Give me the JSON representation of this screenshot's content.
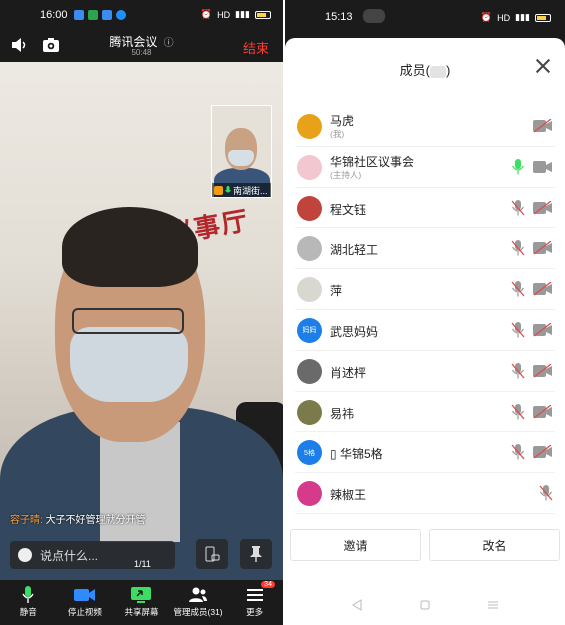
{
  "left": {
    "status": {
      "time": "16:00",
      "indicators": "HD",
      "battery_color": "#ffd24a"
    },
    "header": {
      "title": "腾讯会议",
      "duration": "50:48",
      "end_label": "结束",
      "end_color": "#ff3b30",
      "left_icons": [
        "speaker-icon",
        "switch-camera-icon"
      ],
      "info_icon": "info-icon"
    },
    "video": {
      "background_text": "邻里议事厅",
      "pip_label": "南湖街..."
    },
    "chat": {
      "sender": "容子晴:",
      "message": "大子不好管理就分开管"
    },
    "input": {
      "placeholder": "说点什么..."
    },
    "page_indicator": "1/11",
    "toolbar": [
      {
        "label": "静音",
        "icon": "microphone-icon"
      },
      {
        "label": "停止视频",
        "icon": "video-camera-icon"
      },
      {
        "label": "共享屏幕",
        "icon": "share-screen-icon"
      },
      {
        "label": "管理成员(31)",
        "icon": "members-icon"
      },
      {
        "label": "更多",
        "icon": "menu-icon",
        "badge": "34"
      }
    ]
  },
  "right": {
    "status": {
      "time": "15:13",
      "indicators": "HD"
    },
    "sheet": {
      "title": "成员(",
      "title_end": ")",
      "members": [
        {
          "name": "马虎",
          "sub": "(我)",
          "avatar_color": "#e8a21a",
          "avatar_text": "",
          "mic": "none",
          "cam": "off"
        },
        {
          "name": "华锦社区议事会",
          "sub": "(主持人)",
          "avatar_color": "#f3c7cf",
          "avatar_text": "",
          "mic": "on",
          "cam": "on"
        },
        {
          "name": "程文钰",
          "sub": "",
          "avatar_color": "#c0443c",
          "avatar_text": "",
          "mic": "muted",
          "cam": "off"
        },
        {
          "name": "湖北轻工",
          "sub": "",
          "avatar_color": "#b8b8b8",
          "avatar_text": "",
          "mic": "muted",
          "cam": "off"
        },
        {
          "name": "萍",
          "sub": "",
          "avatar_color": "#d8d8d0",
          "avatar_text": "",
          "mic": "muted",
          "cam": "off"
        },
        {
          "name": "武思妈妈",
          "sub": "",
          "avatar_color": "#1e7ee8",
          "avatar_text": "妈妈",
          "mic": "muted",
          "cam": "off"
        },
        {
          "name": "肖述枰",
          "sub": "",
          "avatar_color": "#6a6a6a",
          "avatar_text": "",
          "mic": "muted",
          "cam": "off"
        },
        {
          "name": "易祎",
          "sub": "",
          "avatar_color": "#7a7a4a",
          "avatar_text": "",
          "mic": "muted",
          "cam": "off"
        },
        {
          "name": "▯ 华锦5格",
          "sub": "",
          "avatar_color": "#1e7ee8",
          "avatar_text": "5格",
          "mic": "muted",
          "cam": "off"
        },
        {
          "name": "辣椒王",
          "sub": "",
          "avatar_color": "#d63a8a",
          "avatar_text": "",
          "mic": "muted",
          "cam": "none"
        }
      ],
      "invite_label": "邀请",
      "rename_label": "改名"
    },
    "navbar": [
      "back-icon",
      "home-icon",
      "recents-icon"
    ]
  }
}
